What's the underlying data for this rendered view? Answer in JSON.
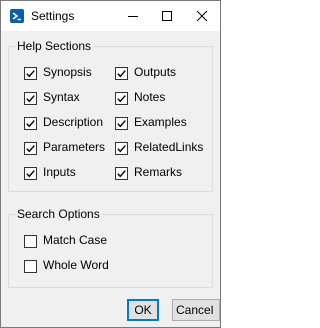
{
  "window": {
    "title": "Settings"
  },
  "title_bar": {
    "icons": [
      "powershell-icon",
      "minimize-icon",
      "maximize-icon",
      "close-icon"
    ]
  },
  "help_sections": {
    "label": "Help Sections",
    "items": [
      {
        "label": "Synopsis",
        "checked": true
      },
      {
        "label": "Outputs",
        "checked": true
      },
      {
        "label": "Syntax",
        "checked": true
      },
      {
        "label": "Notes",
        "checked": true
      },
      {
        "label": "Description",
        "checked": true
      },
      {
        "label": "Examples",
        "checked": true
      },
      {
        "label": "Parameters",
        "checked": true
      },
      {
        "label": "RelatedLinks",
        "checked": true
      },
      {
        "label": "Inputs",
        "checked": true
      },
      {
        "label": "Remarks",
        "checked": true
      }
    ]
  },
  "search_options": {
    "label": "Search Options",
    "items": [
      {
        "label": "Match Case",
        "checked": false
      },
      {
        "label": "Whole Word",
        "checked": false
      }
    ]
  },
  "buttons": {
    "ok_label": "OK",
    "cancel_label": "Cancel"
  },
  "colors": {
    "window_bg": "#f0f0f0",
    "titlebar_bg": "#ffffff",
    "accent": "#0078d7",
    "icon_blue": "#0a5ea8"
  }
}
